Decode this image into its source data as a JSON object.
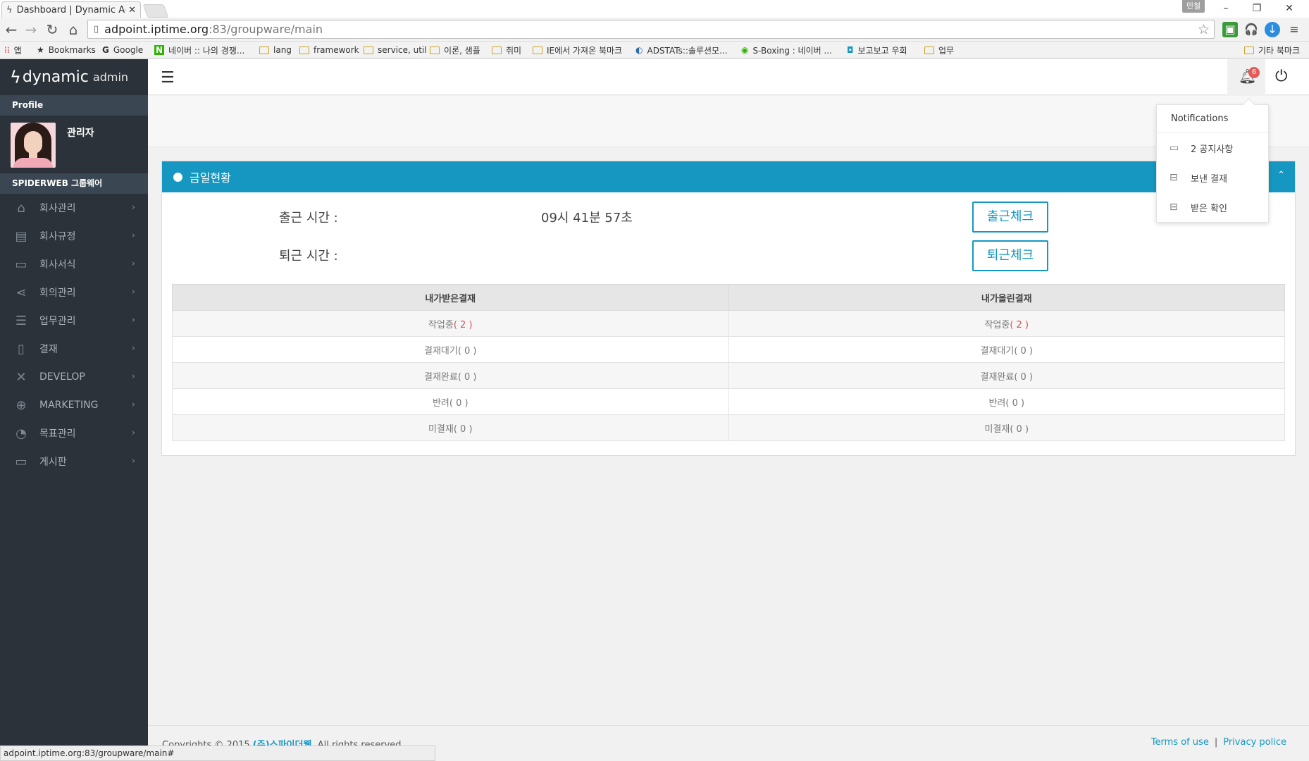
{
  "browser": {
    "tab_title": "Dashboard | Dynamic Ad",
    "tab_close": "✕",
    "user_badge": "민철",
    "url_host": "adpoint.iptime.org",
    "url_rest": ":83/groupware/main",
    "status_url": "adpoint.iptime.org:83/groupware/main#",
    "bookmarks": [
      {
        "label": "앱",
        "icon": "apps-icon"
      },
      {
        "label": "Bookmarks",
        "icon": "star-icon"
      },
      {
        "label": "Google",
        "icon": "google-icon"
      },
      {
        "label": "네이버 :: 나의 경쟁...",
        "icon": "naver-icon"
      },
      {
        "label": "lang",
        "icon": "folder-icon"
      },
      {
        "label": "framework",
        "icon": "folder-icon"
      },
      {
        "label": "service, util",
        "icon": "folder-icon"
      },
      {
        "label": "이론, 샘플",
        "icon": "folder-icon"
      },
      {
        "label": "취미",
        "icon": "folder-icon"
      },
      {
        "label": "IE에서 가져온 북마크",
        "icon": "folder-icon"
      },
      {
        "label": "ADSTATs::솔루션모...",
        "icon": "adstat-icon"
      },
      {
        "label": "S-Boxing : 네이버 ...",
        "icon": "sboxing-icon"
      },
      {
        "label": "보고보고 우회",
        "icon": "site-icon"
      },
      {
        "label": "업무",
        "icon": "folder-icon"
      },
      {
        "label": "기타 북마크",
        "icon": "folder-icon"
      }
    ]
  },
  "sidebar": {
    "logo_main": "dynamic",
    "logo_sub": "admin",
    "profile_header": "Profile",
    "profile_name": "관리자",
    "group_header": "SPIDERWEB 그룹웨어",
    "items": [
      {
        "label": "회사관리",
        "icon": "home-icon"
      },
      {
        "label": "회사규정",
        "icon": "document-icon"
      },
      {
        "label": "회사서식",
        "icon": "folder-icon"
      },
      {
        "label": "회의관리",
        "icon": "share-icon"
      },
      {
        "label": "업무관리",
        "icon": "database-icon"
      },
      {
        "label": "결재",
        "icon": "clipboard-icon"
      },
      {
        "label": "DEVELOP",
        "icon": "tools-icon"
      },
      {
        "label": "MARKETING",
        "icon": "globe-icon"
      },
      {
        "label": "목표관리",
        "icon": "pie-chart-icon"
      },
      {
        "label": "게시판",
        "icon": "chat-icon"
      }
    ]
  },
  "topbar": {
    "notification_count": "6"
  },
  "notifications": {
    "title": "Notifications",
    "items": [
      {
        "label": "2 공지사항",
        "icon": "comment-icon"
      },
      {
        "label": "보낸 결재",
        "icon": "inbox-icon"
      },
      {
        "label": "받은 확인",
        "icon": "inbox-icon"
      }
    ]
  },
  "panel": {
    "title": "금일현황",
    "checkin_label": "출근 시간 :",
    "checkin_value": "09시 41분 57초",
    "checkout_label": "퇴근 시간 :",
    "checkin_button": "출근체크",
    "checkout_button": "퇴근체크",
    "table": {
      "headers": [
        "내가받은결재",
        "내가올린결재"
      ],
      "rows": [
        {
          "left": "작업중",
          "left_count": "( 2 )",
          "right": "작업중",
          "right_count": "( 2 )",
          "highlight": true
        },
        {
          "left": "결재대기",
          "left_count": "( 0 )",
          "right": "결재대기",
          "right_count": "( 0 )",
          "highlight": false
        },
        {
          "left": "결재완료",
          "left_count": "( 0 )",
          "right": "결재완료",
          "right_count": "( 0 )",
          "highlight": false
        },
        {
          "left": "반려",
          "left_count": "( 0 )",
          "right": "반려",
          "right_count": "( 0 )",
          "highlight": false
        },
        {
          "left": "미결재",
          "left_count": "( 0 )",
          "right": "미결재",
          "right_count": "( 0 )",
          "highlight": false
        }
      ]
    }
  },
  "footer": {
    "copyright_prefix": "Copyrights © 2015",
    "copyright_brand": "(주)스파이더웹",
    "copyright_suffix": ". All rights reserved.",
    "terms": "Terms of use",
    "separator": "|",
    "privacy": "Privacy police"
  },
  "colors": {
    "accent": "#1597c1",
    "sidebar_bg": "#2b323a",
    "badge_red": "#e45b5b",
    "count_red": "#d9534f"
  }
}
